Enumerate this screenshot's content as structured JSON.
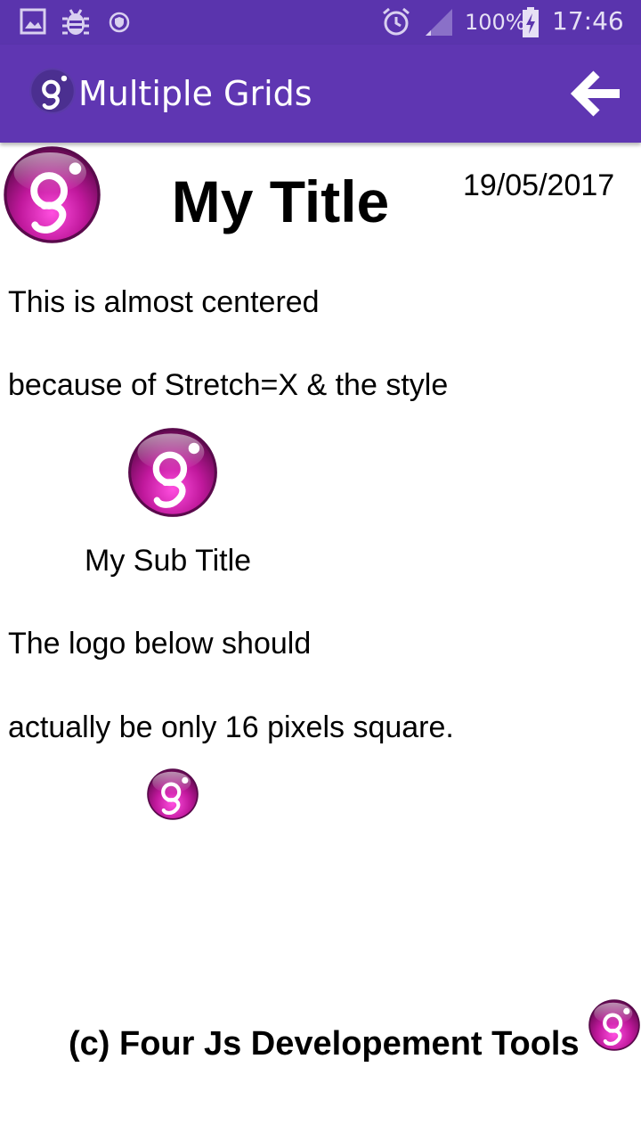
{
  "status_bar": {
    "battery": "100%",
    "time": "17:46",
    "icons": [
      "image-icon",
      "bug-icon",
      "shield-icon",
      "alarm-icon",
      "signal-icon",
      "battery-charging-icon"
    ]
  },
  "app_bar": {
    "title": "Multiple Grids",
    "back_icon": "arrow-left-icon"
  },
  "header": {
    "title": "My Title",
    "date": "19/05/2017"
  },
  "content": {
    "line1": "This is almost centered",
    "line2": "because of Stretch=X & the style",
    "subtitle": "My Sub Title",
    "line3": "The logo below should",
    "line4": "actually be only 16 pixels square."
  },
  "footer": {
    "text": "(c) Four Js Developement Tools"
  },
  "colors": {
    "app_bar": "#5f36b2",
    "status_bar": "#5a34ad",
    "logo_magenta": "#c0189c"
  }
}
